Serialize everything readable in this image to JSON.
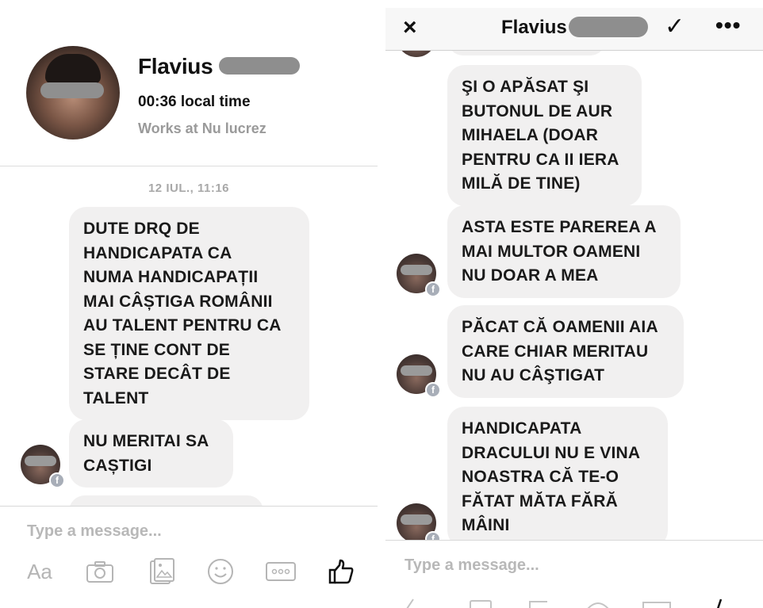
{
  "left": {
    "profile": {
      "name": "Flavius",
      "local_time": "00:36 local time",
      "work": "Works at Nu lucrez"
    },
    "timestamp": "12 IUL., 11:16",
    "messages": [
      "DUTE DRQ DE\nHANDICAPATA CA\nNUMA HANDICAPAȚII\nMAI CÂȘTIGA ROMÂNII\nAU TALENT PENTRU CA\nSE ȚINE CONT DE\nSTARE DECÂT DE\nTALENT",
      "NU MERITAI SA\nCAȘTIGI"
    ],
    "composer": {
      "placeholder": "Type a message...",
      "text_tool": "Aa"
    }
  },
  "right": {
    "header": {
      "close_icon": "×",
      "title": "Flavius",
      "confirm_icon": "✓",
      "more_icon": "•••"
    },
    "messages": [
      "ŞI O APĂSAT ŞI\nBUTONUL DE AUR\nMIHAELA (DOAR\nPENTRU CA II IERA\nMILĂ DE TINE)",
      "ASTA ESTE PAREREA A\nMAI MULTOR OAMENI\nNU DOAR A MEA",
      "PĂCAT CĂ OAMENII AIA\nCARE CHIAR MERITAU\nNU AU CÂŞTIGAT",
      "HANDICAPATA\nDRACULUI NU E VINA\nNOASTRA CĂ TE-O\nFĂTAT MĂTA FĂRĂ\nMÂINI"
    ],
    "composer": {
      "placeholder": "Type a message..."
    }
  },
  "badge": "f",
  "colors": {
    "bubble": "#f1f0f0",
    "muted_text": "#a8a8a8",
    "redaction": "#8e8e8e"
  }
}
